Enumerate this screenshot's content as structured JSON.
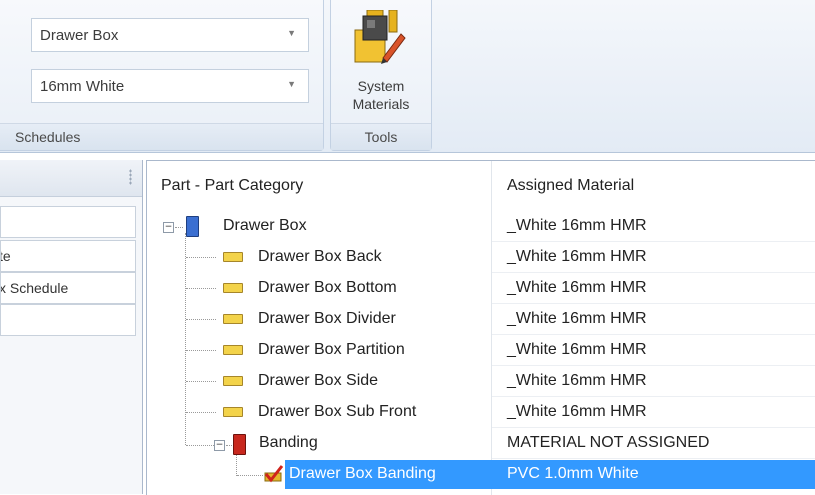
{
  "ribbon": {
    "schedules_group": {
      "combo1_value": "Drawer Box",
      "combo2_value": "16mm White",
      "label": "Schedules"
    },
    "tools_group": {
      "button_line1": "System",
      "button_line2": "Materials",
      "label": "Tools"
    }
  },
  "left_panel": {
    "items": [
      "",
      "te",
      "x Schedule",
      ""
    ]
  },
  "tree": {
    "columns": [
      "Part - Part Category",
      "Assigned Material"
    ],
    "rows": [
      {
        "name": "Drawer Box",
        "material": "_White 16mm HMR"
      },
      {
        "name": "Drawer Box Back",
        "material": "_White 16mm HMR"
      },
      {
        "name": "Drawer Box Bottom",
        "material": "_White 16mm HMR"
      },
      {
        "name": "Drawer Box Divider",
        "material": "_White 16mm HMR"
      },
      {
        "name": "Drawer Box Partition",
        "material": "_White 16mm HMR"
      },
      {
        "name": "Drawer Box Side",
        "material": "_White 16mm HMR"
      },
      {
        "name": "Drawer Box Sub Front",
        "material": "_White 16mm HMR"
      },
      {
        "name": "Banding",
        "material": "MATERIAL NOT ASSIGNED"
      },
      {
        "name": "Drawer Box Banding",
        "material": "PVC 1.0mm White"
      }
    ]
  },
  "colors": {
    "selection": "#3399ff",
    "category_blue": "#3b6fd1",
    "category_red": "#c8281e",
    "part_yellow": "#f3d34a"
  },
  "icons": [
    "chevron-down-icon",
    "system-materials-icon",
    "panel-grip-icon",
    "collapse-icon",
    "blue-book-icon",
    "red-book-icon",
    "part-icon",
    "banding-check-icon"
  ]
}
